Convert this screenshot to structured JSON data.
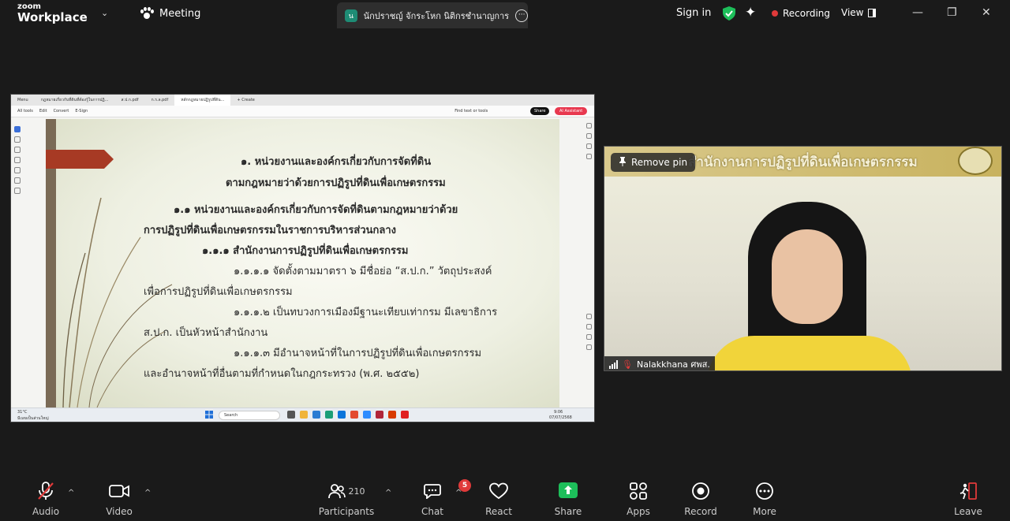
{
  "app": {
    "brand_top": "zoom",
    "brand_bottom": "Workplace"
  },
  "topbar": {
    "meeting_label": "Meeting",
    "share_initial": "น",
    "share_name": "นักปราชญ์ จักระโหก นิติกรชำนาญการ",
    "sign_in": "Sign in",
    "recording": "Recording",
    "view": "View",
    "minimize": "—",
    "restore": "❐",
    "close": "✕"
  },
  "browser": {
    "tabs": [
      "Menu",
      "กฎหมายเกี่ยวกับที่ดินที่ต้องรู้ในการปฏิ...",
      "ส.ป.ก.pdf",
      "ก.ร.ล.pdf",
      "หลักกฎหมายปฏิรูปที่ดิน...",
      "+ Create"
    ],
    "menu": [
      "All tools",
      "Edit",
      "Convert",
      "E-Sign"
    ],
    "find": "Find text or tools",
    "share": "Share",
    "ai": "AI Assistant"
  },
  "slide": {
    "line1": "๑. หน่วยงานและองค์กรเกี่ยวกับการจัดที่ดิน",
    "line2": "ตามกฎหมายว่าด้วยการปฏิรูปที่ดินเพื่อเกษตรกรรม",
    "line3": "๑.๑ หน่วยงานและองค์กรเกี่ยวกับการจัดที่ดินตามกฎหมายว่าด้วย",
    "line4": "การปฏิรูปที่ดินเพื่อเกษตรกรรมในราชการบริหารส่วนกลาง",
    "line5": "๑.๑.๑ สำนักงานการปฏิรูปที่ดินเพื่อเกษตรกรรม",
    "line6": "๑.๑.๑.๑ จัดตั้งตามมาตรา ๖ มีชื่อย่อ “ส.ป.ก.” วัตถุประสงค์",
    "line7": "เพื่อการปฏิรูปที่ดินเพื่อเกษตรกรรม",
    "line8": "๑.๑.๑.๒ เป็นทบวงการเมืองมีฐานะเทียบเท่ากรม มีเลขาธิการ",
    "line9": "ส.ป.ก. เป็นหัวหน้าสำนักงาน",
    "line10": "๑.๑.๑.๓ มีอำนาจหน้าที่ในการปฏิรูปที่ดินเพื่อเกษตรกรรม",
    "line11": "และอำนาจหน้าที่อื่นตามที่กำหนดในกฎกระทรวง (พ.ศ. ๒๕๕๒)"
  },
  "taskbar": {
    "weather": "31°C",
    "weather_sub": "มีเมฆเป็นส่วนใหญ่",
    "search": "Search",
    "time": "9:06",
    "date": "07/07/2568"
  },
  "video": {
    "banner": "สำนักงานการปฏิรูปที่ดินเพื่อเกษตรกรรม",
    "remove_pin": "Remove pin",
    "name": "Nalakkhana ศพส."
  },
  "toolbar": {
    "audio": "Audio",
    "video": "Video",
    "participants": "Participants",
    "participants_count": "210",
    "chat": "Chat",
    "chat_badge": "5",
    "react": "React",
    "share": "Share",
    "apps": "Apps",
    "record": "Record",
    "more": "More",
    "leave": "Leave"
  },
  "colors": {
    "recording_dot": "#e03a3a",
    "share_green": "#1dbe5a",
    "shield_green": "#1dbe5a"
  }
}
